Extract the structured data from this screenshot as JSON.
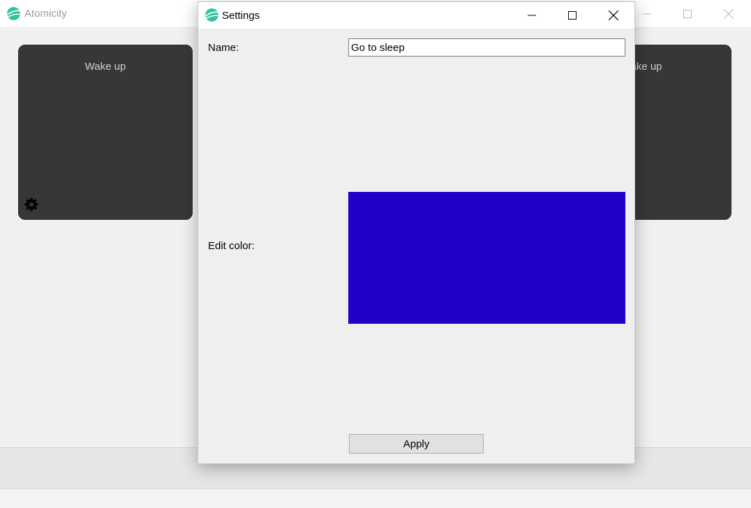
{
  "main_window": {
    "title": "Atomicity",
    "cards": [
      {
        "title": "Wake up"
      },
      {
        "title": "ake up"
      }
    ]
  },
  "dialog": {
    "title": "Settings",
    "name_label": "Name:",
    "name_value": "Go to sleep",
    "color_label": "Edit color:",
    "color_value": "#2100c8",
    "apply_label": "Apply"
  },
  "colors": {
    "card_bg": "#373737",
    "logo": "#2ec4a0",
    "swatch": "#2100c8"
  },
  "icons": {
    "logo": "app-logo-icon",
    "gear": "gear-icon",
    "minimize": "minimize-icon",
    "maximize": "maximize-icon",
    "close": "close-icon"
  }
}
